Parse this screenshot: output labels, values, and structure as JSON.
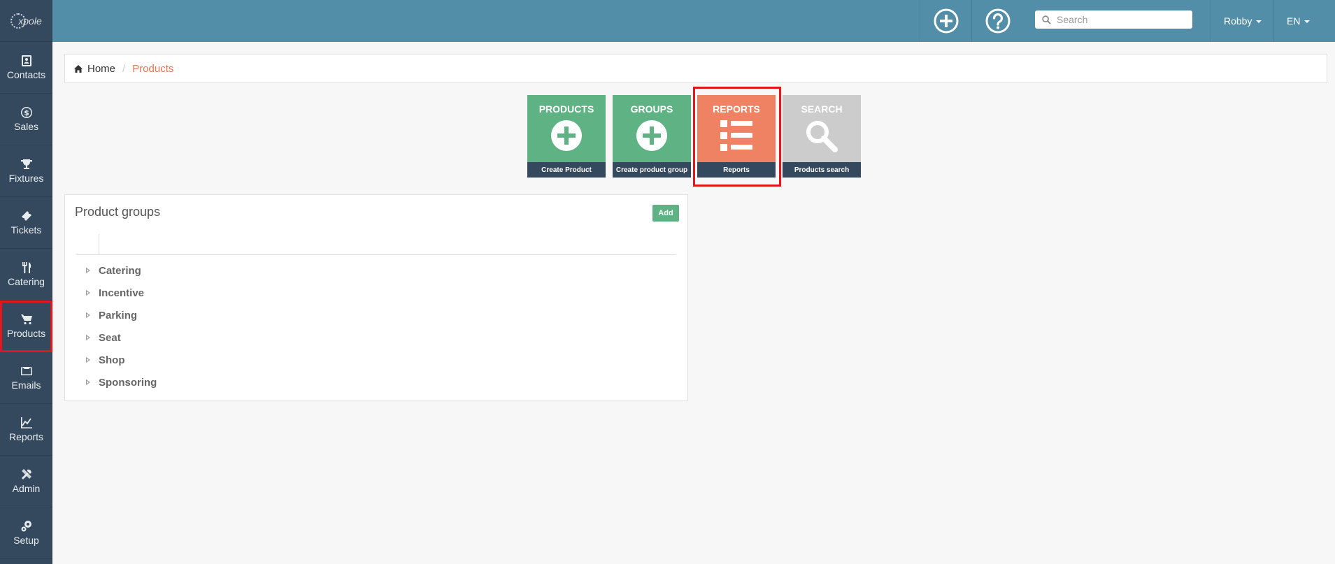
{
  "app": {
    "logo_text": "xpole"
  },
  "sidebar": {
    "items": [
      {
        "label": "Contacts",
        "icon": "contacts-icon"
      },
      {
        "label": "Sales",
        "icon": "dollar-icon"
      },
      {
        "label": "Fixtures",
        "icon": "trophy-icon"
      },
      {
        "label": "Tickets",
        "icon": "ticket-icon"
      },
      {
        "label": "Catering",
        "icon": "cutlery-icon"
      },
      {
        "label": "Products",
        "icon": "cart-icon"
      },
      {
        "label": "Emails",
        "icon": "envelope-icon"
      },
      {
        "label": "Reports",
        "icon": "chart-icon"
      },
      {
        "label": "Admin",
        "icon": "tools-icon"
      },
      {
        "label": "Setup",
        "icon": "gears-icon"
      }
    ]
  },
  "topbar": {
    "search_placeholder": "Search",
    "user": "Robby",
    "language": "EN"
  },
  "breadcrumb": {
    "home": "Home",
    "current": "Products"
  },
  "tiles": [
    {
      "title": "PRODUCTS",
      "footer": "Create Product",
      "icon": "plus-circle-icon",
      "color": "#5fb283"
    },
    {
      "title": "GROUPS",
      "footer": "Create product group",
      "icon": "plus-circle-icon",
      "color": "#5fb283"
    },
    {
      "title": "REPORTS",
      "footer": "Reports",
      "icon": "list-icon",
      "color": "#ef8262"
    },
    {
      "title": "SEARCH",
      "footer": "Products search",
      "icon": "magnifier-icon",
      "color": "#cccccc"
    }
  ],
  "product_groups": {
    "title": "Product groups",
    "add_label": "Add",
    "items": [
      "Catering",
      "Incentive",
      "Parking",
      "Seat",
      "Shop",
      "Sponsoring"
    ]
  }
}
